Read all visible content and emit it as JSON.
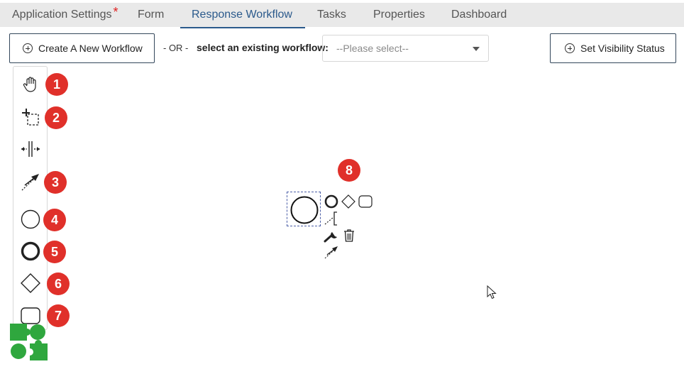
{
  "tabs": [
    {
      "label": "Application Settings",
      "required_marker": "*"
    },
    {
      "label": "Form"
    },
    {
      "label": "Response Workflow",
      "active": true
    },
    {
      "label": "Tasks"
    },
    {
      "label": "Properties"
    },
    {
      "label": "Dashboard"
    }
  ],
  "toolbar": {
    "create_label": "Create A New Workflow",
    "or_label": "- OR -",
    "select_label": "select an existing workflow:",
    "select_value": "--Please select--",
    "visibility_label": "Set Visibility Status"
  },
  "palette": {
    "tools": [
      {
        "icon": "hand-tool-icon",
        "badge": "1"
      },
      {
        "icon": "lasso-tool-icon",
        "badge": "2"
      },
      {
        "icon": "space-tool-icon",
        "badge": ""
      },
      {
        "icon": "connect-tool-icon",
        "badge": "3"
      },
      {
        "icon": "start-event-icon",
        "badge": "4"
      },
      {
        "icon": "end-event-icon",
        "badge": "5"
      },
      {
        "icon": "gateway-icon",
        "badge": "6"
      },
      {
        "icon": "task-icon",
        "badge": "7"
      }
    ]
  },
  "canvas": {
    "context_badge": "8",
    "context_pad": [
      "end-event-icon",
      "gateway-icon",
      "task-icon",
      "annotation-icon",
      "wrench-icon",
      "trash-icon",
      "connect-icon"
    ]
  },
  "colors": {
    "accent": "#2b5a8c",
    "badge": "#e0302a",
    "logo": "#2fa73e",
    "selection": "#4c5fa8"
  }
}
